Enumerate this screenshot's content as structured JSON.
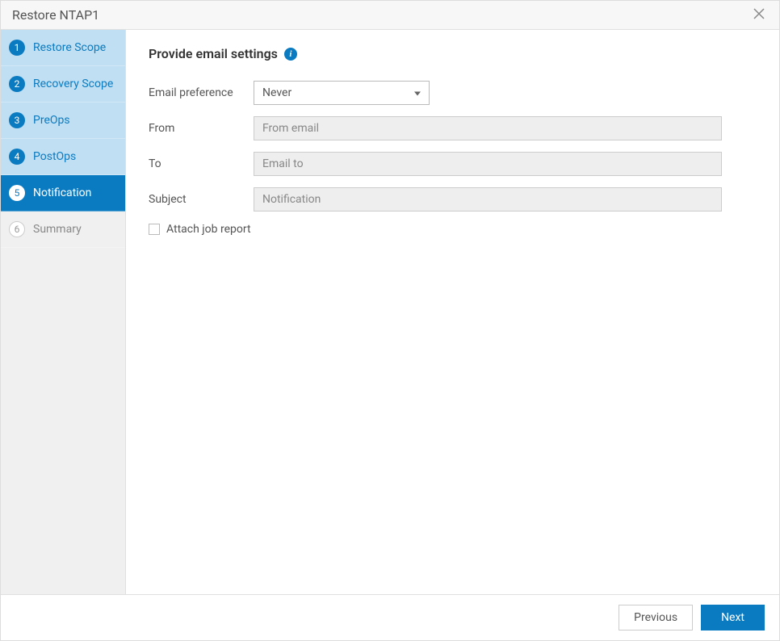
{
  "header": {
    "title": "Restore NTAP1"
  },
  "sidebar": {
    "steps": [
      {
        "num": "1",
        "label": "Restore Scope"
      },
      {
        "num": "2",
        "label": "Recovery Scope"
      },
      {
        "num": "3",
        "label": "PreOps"
      },
      {
        "num": "4",
        "label": "PostOps"
      },
      {
        "num": "5",
        "label": "Notification"
      },
      {
        "num": "6",
        "label": "Summary"
      }
    ]
  },
  "content": {
    "title": "Provide email settings",
    "fields": {
      "email_preference": {
        "label": "Email preference",
        "value": "Never"
      },
      "from": {
        "label": "From",
        "placeholder": "From email"
      },
      "to": {
        "label": "To",
        "placeholder": "Email to"
      },
      "subject": {
        "label": "Subject",
        "placeholder": "Notification"
      }
    },
    "attach_label": "Attach job report"
  },
  "footer": {
    "previous": "Previous",
    "next": "Next"
  }
}
